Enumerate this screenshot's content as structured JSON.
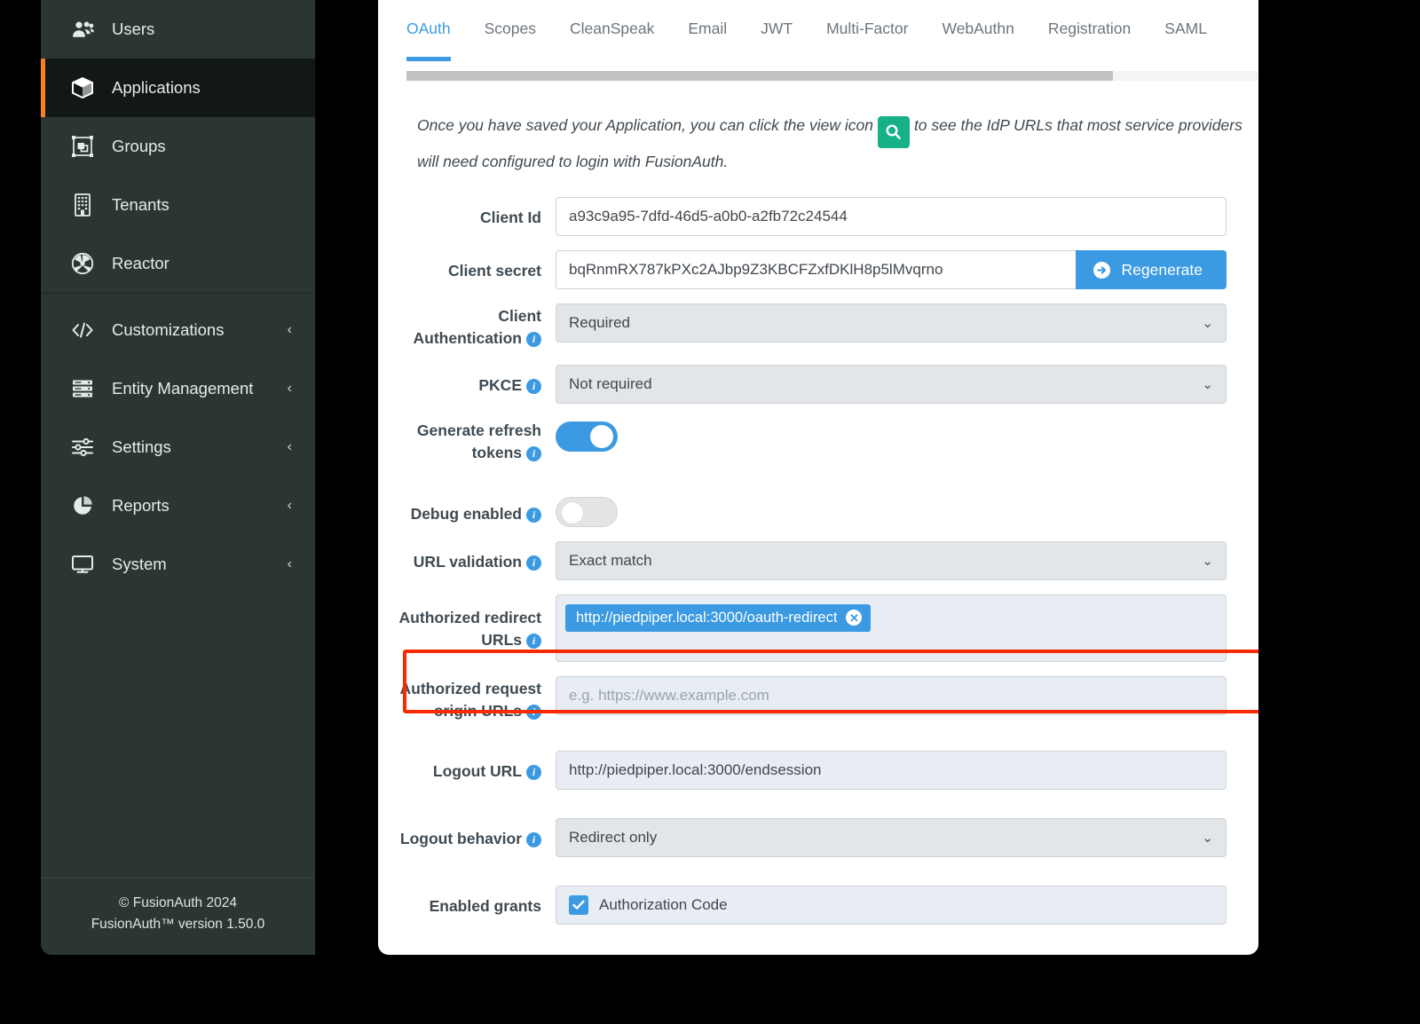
{
  "sidebar": {
    "items": [
      {
        "label": "Users",
        "icon": "users-icon",
        "active": false,
        "expandable": false
      },
      {
        "label": "Applications",
        "icon": "cube-icon",
        "active": true,
        "expandable": false
      },
      {
        "label": "Groups",
        "icon": "groups-icon",
        "active": false,
        "expandable": false
      },
      {
        "label": "Tenants",
        "icon": "building-icon",
        "active": false,
        "expandable": false
      },
      {
        "label": "Reactor",
        "icon": "reactor-icon",
        "active": false,
        "expandable": false
      },
      {
        "label": "Customizations",
        "icon": "code-icon",
        "active": false,
        "expandable": true
      },
      {
        "label": "Entity Management",
        "icon": "server-icon",
        "active": false,
        "expandable": true
      },
      {
        "label": "Settings",
        "icon": "sliders-icon",
        "active": false,
        "expandable": true
      },
      {
        "label": "Reports",
        "icon": "pie-chart-icon",
        "active": false,
        "expandable": true
      },
      {
        "label": "System",
        "icon": "monitor-icon",
        "active": false,
        "expandable": true
      }
    ],
    "chevron": "‹",
    "footer": {
      "copyright": "© FusionAuth 2024",
      "version": "FusionAuth™ version 1.50.0"
    },
    "accent_color": "#f4821f",
    "background_color": "#2b3634",
    "active_background_color": "#121717"
  },
  "tabs": [
    {
      "label": "OAuth",
      "active": true
    },
    {
      "label": "Scopes",
      "active": false
    },
    {
      "label": "CleanSpeak",
      "active": false
    },
    {
      "label": "Email",
      "active": false
    },
    {
      "label": "JWT",
      "active": false
    },
    {
      "label": "Multi-Factor",
      "active": false
    },
    {
      "label": "WebAuthn",
      "active": false
    },
    {
      "label": "Registration",
      "active": false
    },
    {
      "label": "SAML",
      "active": false
    }
  ],
  "intro": {
    "text_before": "Once you have saved your Application, you can click the view icon",
    "text_after": "to see the IdP URLs that most service providers will need configured to login with FusionAuth.",
    "icon_name": "search-icon",
    "icon_color": "#16b187"
  },
  "form": {
    "client_id": {
      "label": "Client Id",
      "value": "a93c9a95-7dfd-46d5-a0b0-a2fb72c24544"
    },
    "client_secret": {
      "label": "Client secret",
      "value": "bqRnmRX787kPXc2AJbp9Z3KBCFZxfDKlH8p5lMvqrno",
      "button_label": "Regenerate"
    },
    "client_authentication": {
      "label_line1": "Client",
      "label_line2": "Authentication",
      "value": "Required"
    },
    "pkce": {
      "label": "PKCE",
      "value": "Not required"
    },
    "generate_refresh_tokens": {
      "label_line1": "Generate refresh",
      "label_line2": "tokens",
      "state": "on"
    },
    "debug_enabled": {
      "label": "Debug enabled",
      "state": "off"
    },
    "url_validation": {
      "label": "URL validation",
      "value": "Exact match"
    },
    "authorized_redirect_urls": {
      "label_line1": "Authorized redirect",
      "label_line2": "URLs",
      "tags": [
        "http://piedpiper.local:3000/oauth-redirect"
      ]
    },
    "authorized_request_origin_urls": {
      "label_line1": "Authorized request",
      "label_line2": "origin URLs",
      "placeholder": "e.g. https://www.example.com",
      "value": ""
    },
    "logout_url": {
      "label": "Logout URL",
      "value": "http://piedpiper.local:3000/endsession"
    },
    "logout_behavior": {
      "label": "Logout behavior",
      "value": "Redirect only",
      "highlighted": true,
      "highlight_color": "#fa2a00"
    },
    "enabled_grants": {
      "label": "Enabled grants",
      "options": [
        {
          "label": "Authorization Code",
          "checked": true
        }
      ]
    },
    "caret": "⌄"
  },
  "colors": {
    "primary_blue": "#3b9ae1",
    "green": "#16b187",
    "orange": "#f4821f",
    "highlight_red": "#fa2a00"
  }
}
